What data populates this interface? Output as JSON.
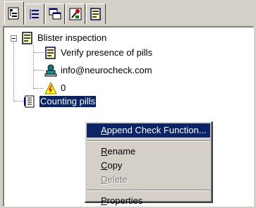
{
  "toolbar": {
    "tabs": [
      {
        "name": "tree-view-tab",
        "icon": "tree-view-icon",
        "active": true
      },
      {
        "name": "sorted-view-tab",
        "icon": "sorted-list-icon",
        "active": false
      },
      {
        "name": "windows-tab",
        "icon": "windows-icon",
        "active": false
      },
      {
        "name": "tools-tab",
        "icon": "tools-icon",
        "active": false
      },
      {
        "name": "document-tab",
        "icon": "document-icon",
        "active": false
      }
    ]
  },
  "tree": {
    "root": {
      "label": "Blister inspection",
      "icon": "document-icon",
      "expanded": true
    },
    "children": [
      {
        "label": "Verify presence of pills",
        "icon": "document-icon"
      },
      {
        "label": "info@neurocheck.com",
        "icon": "user-icon"
      },
      {
        "label": "0",
        "icon": "warning-icon"
      }
    ],
    "selected": {
      "label": "Counting pills",
      "icon": "check-function-icon"
    }
  },
  "context_menu": {
    "items": [
      {
        "accel": "A",
        "rest": "ppend Check Function...",
        "highlighted": true,
        "disabled": false
      },
      {
        "accel": "R",
        "rest": "ename",
        "highlighted": false,
        "disabled": false
      },
      {
        "accel": "C",
        "rest": "opy",
        "highlighted": false,
        "disabled": false
      },
      {
        "accel": "D",
        "rest": "elete",
        "highlighted": false,
        "disabled": true
      },
      {
        "accel": "P",
        "rest": "roperties",
        "highlighted": false,
        "disabled": false
      }
    ]
  },
  "colors": {
    "selection": "#0a246a",
    "face": "#d4d0c8",
    "doc_icon": "#ffff80",
    "doc_border": "#000080"
  }
}
